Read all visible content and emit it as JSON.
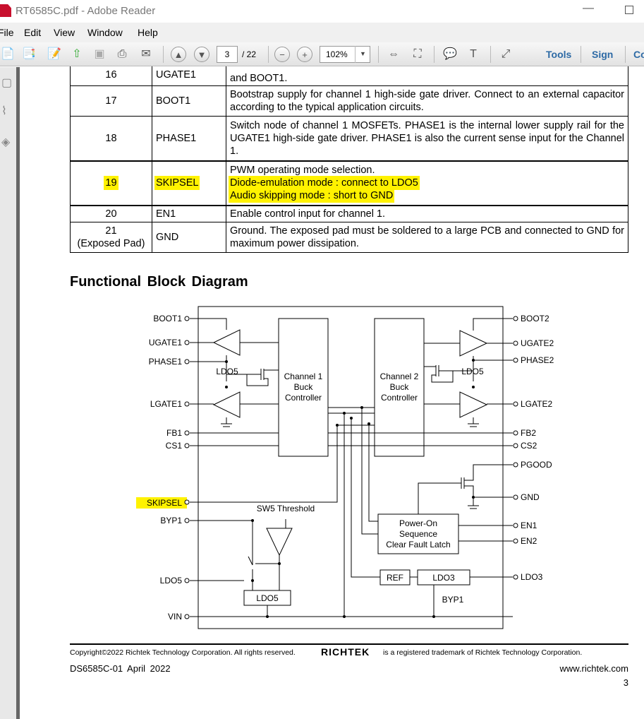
{
  "window": {
    "title": "RT6585C.pdf - Adobe Reader"
  },
  "menu": [
    "File",
    "Edit",
    "View",
    "Window",
    "Help"
  ],
  "toolbar": {
    "page_current": "3",
    "page_total": "/ 22",
    "zoom": "102%",
    "tools": "Tools",
    "sign": "Sign",
    "comment": "Co"
  },
  "table": {
    "rows": [
      {
        "pin": "16",
        "name": "UGATE1",
        "desc": "and BOOT1."
      },
      {
        "pin": "17",
        "name": "BOOT1",
        "desc": "Bootstrap supply for channel 1 high-side gate driver. Connect to an external capacitor according to the typical application circuits."
      },
      {
        "pin": "18",
        "name": "PHASE1",
        "desc": "Switch node of channel 1 MOSFETs. PHASE1 is the internal lower supply rail for the UGATE1 high-side gate driver. PHASE1 is also the current sense input for the Channel 1."
      },
      {
        "pin": "19",
        "name": "SKIPSEL",
        "desc_lines": [
          "PWM operating mode selection.",
          "Diode-emulation mode : connect to LDO5",
          "Audio skipping mode : short to GND"
        ],
        "highlighted": true
      },
      {
        "pin": "20",
        "name": "EN1",
        "desc": "Enable control input for channel 1."
      },
      {
        "pin": "21",
        "pin_note": "(Exposed Pad)",
        "name": "GND",
        "desc": "Ground. The exposed pad must be soldered to a large PCB and connected to GND for maximum power dissipation."
      }
    ]
  },
  "heading": "Functional Block Diagram",
  "diagram": {
    "left_pins": [
      "BOOT1",
      "UGATE1",
      "PHASE1",
      "LGATE1",
      "FB1",
      "CS1",
      "SKIPSEL",
      "BYP1",
      "LDO5",
      "VIN"
    ],
    "right_pins": [
      "BOOT2",
      "UGATE2",
      "PHASE2",
      "LGATE2",
      "FB2",
      "CS2",
      "PGOOD",
      "GND",
      "EN1",
      "EN2",
      "LDO3"
    ],
    "ch1": [
      "Channel 1",
      "Buck",
      "Controller"
    ],
    "ch2": [
      "Channel 2",
      "Buck",
      "Controller"
    ],
    "poweron": [
      "Power-On",
      "Sequence",
      "Clear Fault Latch"
    ],
    "ldo5_a": "LDO5",
    "ldo5_b": "LDO5",
    "ldo5_box": "LDO5",
    "ref": "REF",
    "ldo3": "LDO3",
    "byp1": "BYP1",
    "sw5": "SW5 Threshold",
    "highlight_color": "#fff200"
  },
  "footer": {
    "copyright": "Copyright©2022 Richtek Technology Corporation. All rights reserved.",
    "brand": "RICHTEK",
    "trademark": "is a registered trademark of Richtek Technology Corporation.",
    "doc": "DS6585C-01   April  2022",
    "url": "www.richtek.com",
    "page": "3"
  }
}
